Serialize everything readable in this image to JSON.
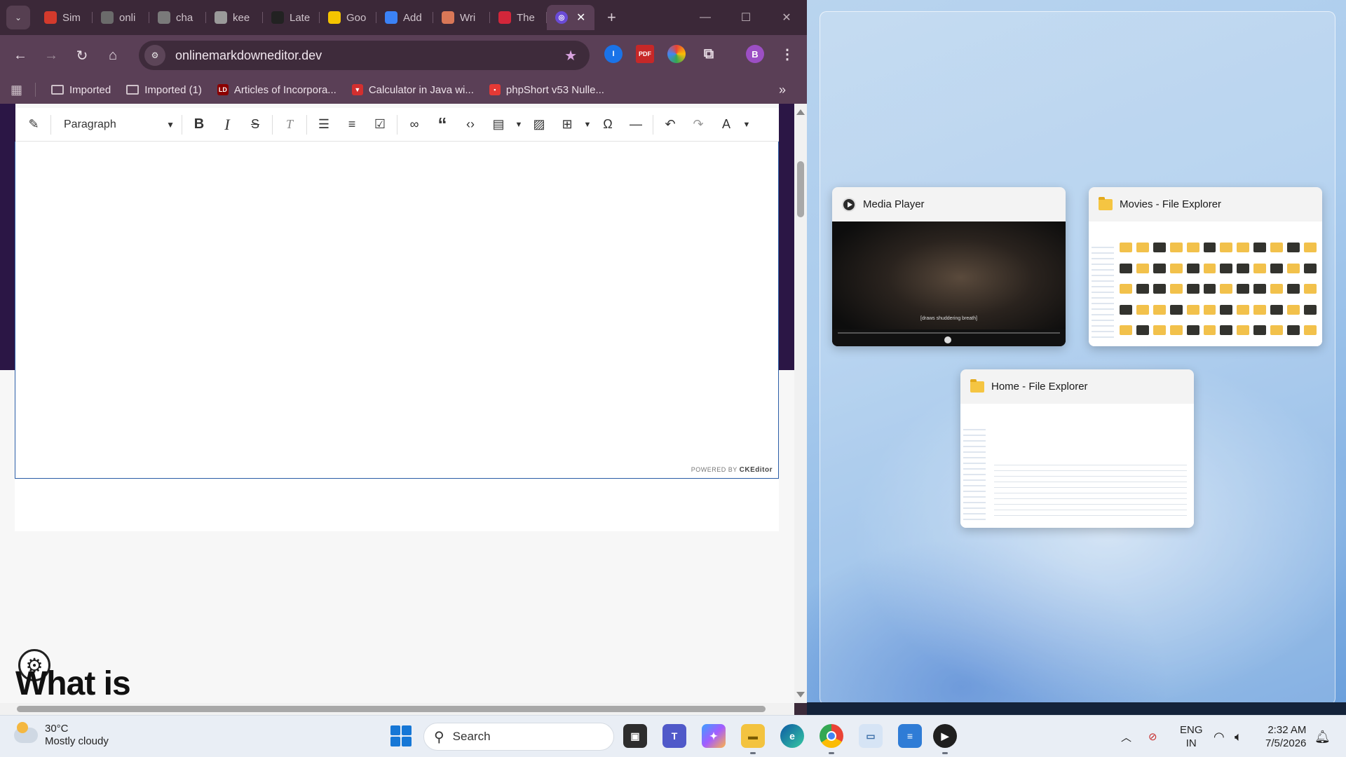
{
  "browser": {
    "tabs": [
      {
        "label": "Sim",
        "icon": "red-slash-icon",
        "color": "#d33a2c"
      },
      {
        "label": "onli",
        "icon": "markdown-icon",
        "color": "#6b6b6b"
      },
      {
        "label": "cha",
        "icon": "m-logo-icon",
        "color": "#7a7a7a"
      },
      {
        "label": "kee",
        "icon": "bulb-grey-icon",
        "color": "#9a9a9a"
      },
      {
        "label": "Late",
        "icon": "wl-logo-icon",
        "color": "#222222"
      },
      {
        "label": "Goo",
        "icon": "bulb-yellow-icon",
        "color": "#f5c400"
      },
      {
        "label": "Add",
        "icon": "blue-arrow-icon",
        "color": "#3b82f6"
      },
      {
        "label": "Wri",
        "icon": "claude-icon",
        "color": "#d97757"
      },
      {
        "label": "The",
        "icon": "pc-logo-icon",
        "color": "#d3263a"
      }
    ],
    "active_tab_icon": "copilot-icon",
    "address": "onlinemarkdowneditor.dev",
    "profile_initial": "B",
    "extensions": [
      {
        "name": "1password-icon",
        "glyph": "I",
        "color": "#1a73e8"
      },
      {
        "name": "pdf-icon",
        "glyph": "PDF",
        "color": "#c62828"
      },
      {
        "name": "color-wheel-icon",
        "glyph": "◉",
        "color": "#7b5cd6"
      }
    ],
    "bookmarks": [
      {
        "label": "Imported",
        "type": "folder"
      },
      {
        "label": "Imported (1)",
        "type": "folder"
      },
      {
        "label": "Articles of Incorpora...",
        "type": "site",
        "glyph": "LD",
        "color": "#8b0000"
      },
      {
        "label": "Calculator in Java wi...",
        "type": "site",
        "glyph": "▼",
        "color": "#d32f2f"
      },
      {
        "label": "phpShort v53 Nulle...",
        "type": "site",
        "glyph": "▪",
        "color": "#e53935"
      }
    ]
  },
  "editor": {
    "block_format": "Paragraph",
    "powered_by": "POWERED BY",
    "powered_brand": "CKEditor",
    "heading_text": "What is"
  },
  "snap": {
    "windows": [
      {
        "title": "Media Player",
        "preview_caption": "[draws shuddering breath]"
      },
      {
        "title": "Movies - File Explorer"
      },
      {
        "title": "Home - File Explorer"
      }
    ]
  },
  "taskbar": {
    "weather_temp": "30°C",
    "weather_desc": "Mostly cloudy",
    "search_placeholder": "Search",
    "lang_top": "ENG",
    "lang_bottom": "IN",
    "time": "2:32 AM",
    "date": "7/5/2026"
  }
}
